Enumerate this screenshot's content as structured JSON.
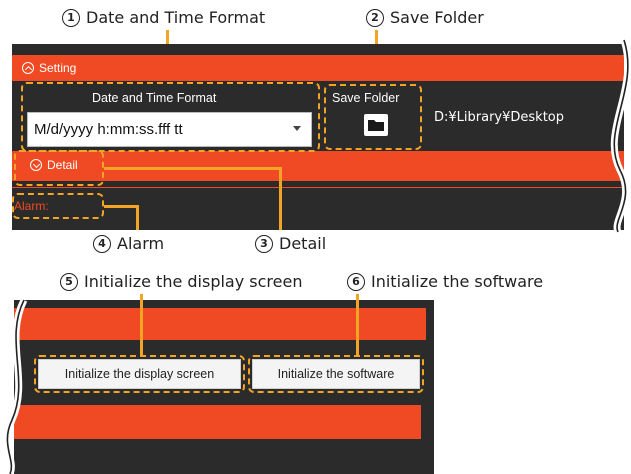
{
  "callouts": {
    "c1": {
      "num": "1",
      "label": "Date and Time Format"
    },
    "c2": {
      "num": "2",
      "label": "Save Folder"
    },
    "c3": {
      "num": "3",
      "label": "Detail"
    },
    "c4": {
      "num": "4",
      "label": "Alarm"
    },
    "c5": {
      "num": "5",
      "label": "Initialize the display screen"
    },
    "c6": {
      "num": "6",
      "label": "Initialize the software"
    }
  },
  "setting_panel": {
    "toggle_label": "Setting",
    "date_format_label": "Date and Time Format",
    "date_format_value": "M/d/yyyy h:mm:ss.fff tt",
    "save_folder_label": "Save Folder",
    "save_folder_path": "D:¥Library¥Desktop",
    "detail_toggle_label": "Detail",
    "alarm_label": "Alarm:"
  },
  "detail_panel": {
    "init_display_button": "Initialize the display screen",
    "init_software_button": "Initialize the software"
  },
  "colors": {
    "accent": "#ef4a23",
    "panel_bg": "#2b2b2b",
    "highlight": "#f3a425"
  },
  "icons": {
    "collapse": "chevron-up-circle-icon",
    "expand": "chevron-down-circle-icon",
    "folder": "folder-icon"
  }
}
